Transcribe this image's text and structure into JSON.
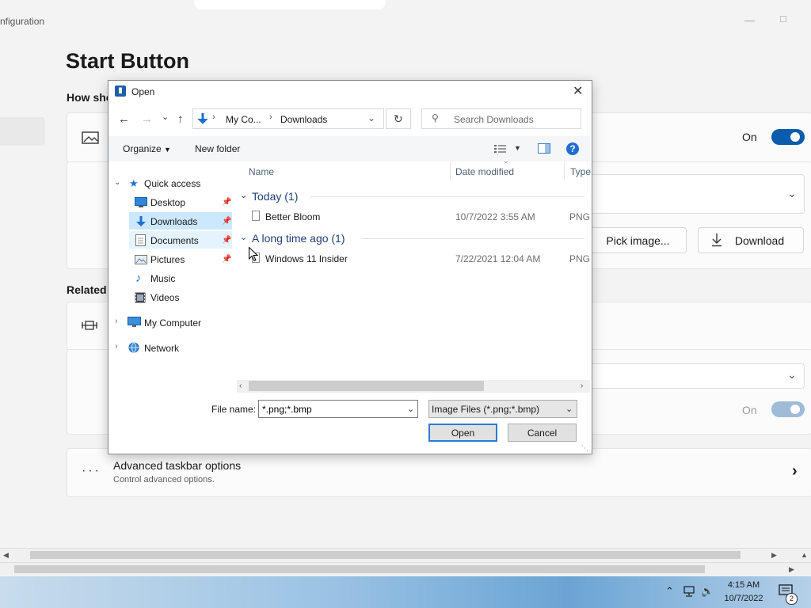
{
  "background_window": {
    "title": "nfiguration",
    "page_title": "Start Button",
    "section_how": "How sho",
    "section_related": "Related",
    "toggle1_state": "On",
    "toggle2_state": "On",
    "pick_image_label": "Pick image...",
    "download_label": "Download",
    "advanced_title": "Advanced taskbar options",
    "advanced_subtitle": "Control advanced options."
  },
  "taskbar": {
    "time": "4:15 AM",
    "date": "10/7/2022",
    "notification_count": "2"
  },
  "dialog": {
    "title": "Open",
    "address": {
      "segment1": "My Co...",
      "segment2": "Downloads"
    },
    "search_placeholder": "Search Downloads",
    "toolbar": {
      "organize": "Organize",
      "new_folder": "New folder"
    },
    "nav": {
      "quick_access": "Quick access",
      "items": [
        {
          "label": "Desktop",
          "pinned": true
        },
        {
          "label": "Downloads",
          "pinned": true
        },
        {
          "label": "Documents",
          "pinned": true
        },
        {
          "label": "Pictures",
          "pinned": true
        },
        {
          "label": "Music",
          "pinned": false
        },
        {
          "label": "Videos",
          "pinned": false
        }
      ],
      "my_computer": "My Computer",
      "network": "Network"
    },
    "columns": {
      "name": "Name",
      "date_modified": "Date modified",
      "type": "Type"
    },
    "groups": [
      {
        "label": "Today (1)",
        "files": [
          {
            "name": "Better Bloom",
            "date": "10/7/2022 3:55 AM",
            "type": "PNG"
          }
        ]
      },
      {
        "label": "A long time ago (1)",
        "files": [
          {
            "name": "Windows 11 Insider",
            "date": "7/22/2021 12:04 AM",
            "type": "PNG"
          }
        ]
      }
    ],
    "file_name_label": "File name:",
    "file_name_value": "*.png;*.bmp",
    "file_type_value": "Image Files (*.png;*.bmp)",
    "open_label": "Open",
    "cancel_label": "Cancel"
  }
}
